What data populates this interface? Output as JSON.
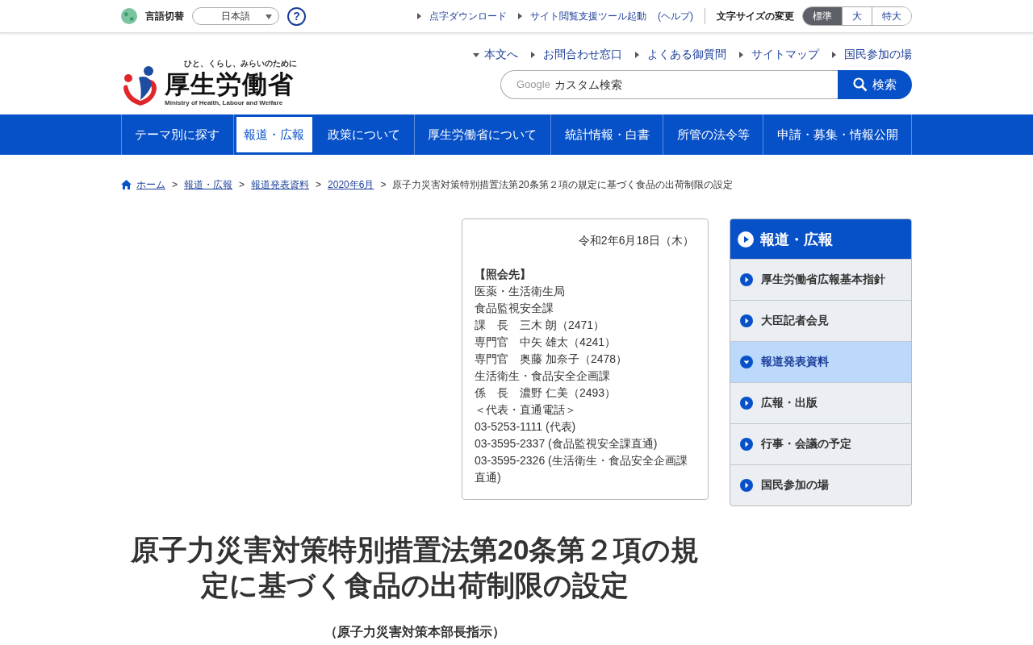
{
  "utility_bar": {
    "language_label": "言語切替",
    "language_select": "日本語",
    "help": "?",
    "links": [
      {
        "label": "点字ダウンロード"
      },
      {
        "label": "サイト閲覧支援ツール起動"
      }
    ],
    "help_link": "(ヘルプ)",
    "font_size_label": "文字サイズの変更",
    "font_sizes": [
      {
        "label": "標準",
        "selected": true
      },
      {
        "label": "大",
        "selected": false
      },
      {
        "label": "特大",
        "selected": false
      }
    ]
  },
  "header": {
    "logo": {
      "tagline": "ひと、くらし、みらいのために",
      "name": "厚生労働省",
      "english": "Ministry of Health, Labour and Welfare"
    },
    "links": [
      {
        "label": "本文へ",
        "kind": "down"
      },
      {
        "label": "お問合わせ窓口",
        "kind": "next"
      },
      {
        "label": "よくある御質問",
        "kind": "next"
      },
      {
        "label": "サイトマップ",
        "kind": "next"
      },
      {
        "label": "国民参加の場",
        "kind": "next"
      }
    ],
    "search": {
      "brand": "Google",
      "placeholder": "カスタム検索",
      "button": "検索"
    }
  },
  "nav": [
    {
      "label": "テーマ別に探す",
      "selected": false
    },
    {
      "label": "報道・広報",
      "selected": true
    },
    {
      "label": "政策について",
      "selected": false
    },
    {
      "label": "厚生労働省について",
      "selected": false
    },
    {
      "label": "統計情報・白書",
      "selected": false
    },
    {
      "label": "所管の法令等",
      "selected": false
    },
    {
      "label": "申請・募集・情報公開",
      "selected": false
    }
  ],
  "breadcrumb": {
    "separator": ">",
    "links": [
      "ホーム",
      "報道・広報",
      "報道発表資料",
      "2020年6月"
    ],
    "current": "原子力災害対策特別措置法第20条第２項の規定に基づく食品の出荷制限の設定"
  },
  "contact": {
    "date": "令和2年6月18日（木）",
    "heading": "【照会先】",
    "lines": [
      "医薬・生活衛生局",
      "食品監視安全課",
      "課　長　三木 朗（2471）",
      "専門官　中矢 雄太（4241）",
      "専門官　奥藤 加奈子（2478）",
      "生活衛生・食品安全企画課",
      "係　長　濃野 仁美（2493）",
      "＜代表・直通電話＞",
      "03-5253-1111 (代表)",
      "03-3595-2337 (食品監視安全課直通)",
      "03-3595-2326 (生活衛生・食品安全企画課直通)"
    ]
  },
  "title": "原子力災害対策特別措置法第20条第２項の規定に基づく食品の出荷制限の設定",
  "subtitle": "（原子力災害対策本部長指示）",
  "sidebar": {
    "title": "報道・広報",
    "items": [
      {
        "label": "厚生労働省広報基本指針",
        "selected": false
      },
      {
        "label": "大臣記者会見",
        "selected": false
      },
      {
        "label": "報道発表資料",
        "selected": true
      },
      {
        "label": "広報・出版",
        "selected": false
      },
      {
        "label": "行事・会議の予定",
        "selected": false
      },
      {
        "label": "国民参加の場",
        "selected": false
      }
    ]
  }
}
